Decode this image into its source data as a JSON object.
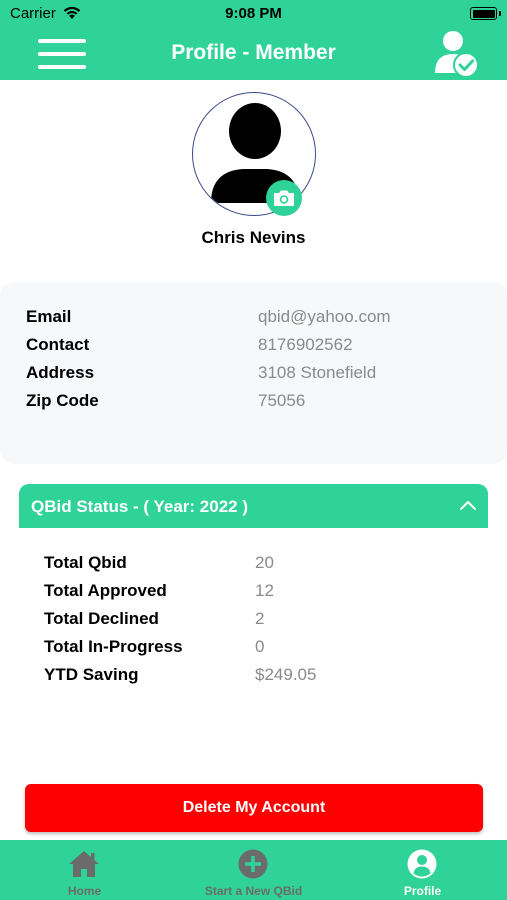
{
  "status_bar": {
    "carrier": "Carrier",
    "time": "9:08 PM"
  },
  "nav": {
    "title": "Profile - Member",
    "menu_icon": "hamburger-menu-icon",
    "right_icon": "verified-user-icon"
  },
  "profile": {
    "name": "Chris  Nevins",
    "avatar_icon": "person-silhouette-icon",
    "camera_icon": "camera-icon"
  },
  "info": {
    "rows": [
      {
        "label": "Email",
        "value": "qbid@yahoo.com"
      },
      {
        "label": "Contact",
        "value": "8176902562"
      },
      {
        "label": "Address",
        "value": "3108 Stonefield"
      },
      {
        "label": "Zip Code",
        "value": "75056"
      }
    ]
  },
  "qbid_status": {
    "title": "QBid Status - ( Year: 2022 )",
    "rows": [
      {
        "label": "Total Qbid",
        "value": "20"
      },
      {
        "label": "Total Approved",
        "value": "12"
      },
      {
        "label": "Total Declined",
        "value": "2"
      },
      {
        "label": "Total In-Progress",
        "value": "0"
      },
      {
        "label": "YTD Saving",
        "value": "$249.05"
      }
    ]
  },
  "delete_button": {
    "label": "Delete My Account"
  },
  "tabs": [
    {
      "label": "Home",
      "icon": "home-icon",
      "active": false
    },
    {
      "label": "Start a New QBid",
      "icon": "plus-circle-icon",
      "active": false
    },
    {
      "label": "Profile",
      "icon": "profile-icon",
      "active": true
    }
  ],
  "colors": {
    "accent": "#2fd39a",
    "danger": "#ff0000",
    "value_text": "#8a8a8a"
  }
}
